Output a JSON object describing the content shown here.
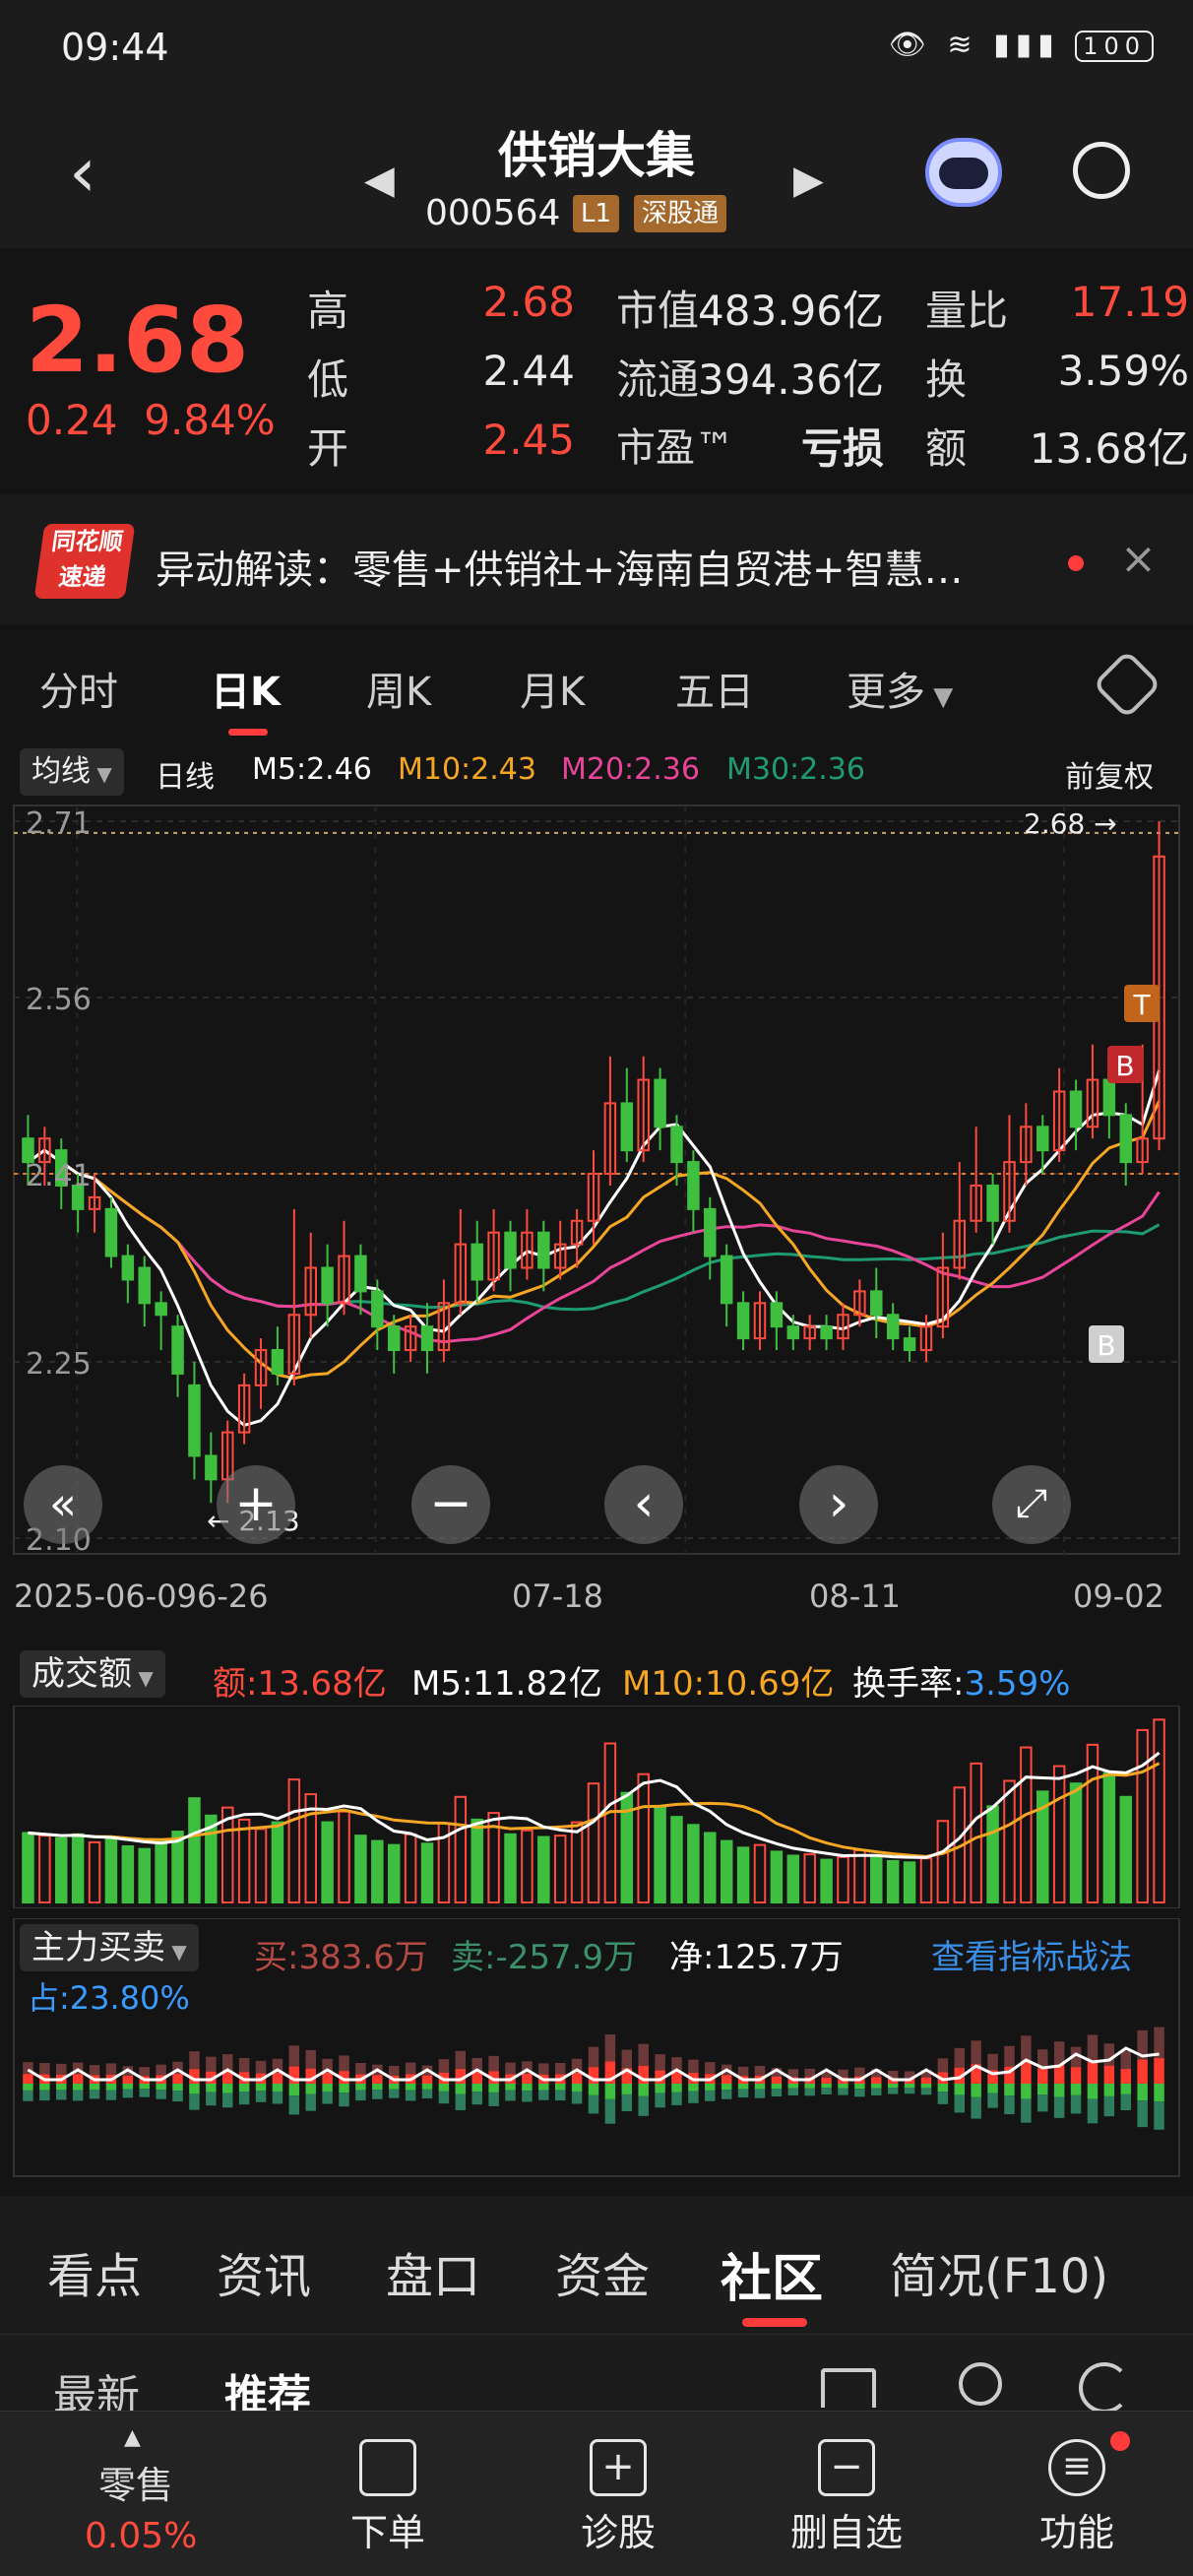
{
  "status": {
    "time": "09:44",
    "battery": "100"
  },
  "nav": {
    "title": "供销大集",
    "code": "000564",
    "level": "L1",
    "market": "深股通"
  },
  "quote": {
    "price": "2.68",
    "change": "0.24",
    "change_pct": "9.84%",
    "labels": {
      "high": "高",
      "low": "低",
      "open": "开",
      "mcap": "市值",
      "float": "流通",
      "pe": "市盈™",
      "vol_ratio": "量比",
      "turnover": "换",
      "amount": "额"
    },
    "high": "2.68",
    "low": "2.44",
    "open": "2.45",
    "mcap": "483.96亿",
    "float_cap": "394.36亿",
    "pe": "亏损",
    "vol_ratio": "17.19",
    "turnover": "3.59%",
    "amount": "13.68亿"
  },
  "news": {
    "brand_top": "同花顺",
    "brand_bottom": "速递",
    "text": "异动解读：零售+供销社+海南自贸港+智慧…"
  },
  "tabs": [
    "分时",
    "日K",
    "周K",
    "月K",
    "五日",
    "更多"
  ],
  "ma": {
    "selector": "均线",
    "period": "日线",
    "m5": "M5:2.46",
    "m10": "M10:2.43",
    "m20": "M20:2.36",
    "m30": "M30:2.36",
    "adjust": "前复权"
  },
  "price_axis": {
    "labels": [
      "2.71",
      "2.56",
      "2.41",
      "2.25",
      "2.10"
    ],
    "high_label": "2.68",
    "low_label": "2.13"
  },
  "date_axis": [
    "2025-06-09",
    "6-26",
    "07-18",
    "08-11",
    "09-02"
  ],
  "markers": {
    "t": "T",
    "b": "B"
  },
  "volume": {
    "selector": "成交额",
    "amount": "额:13.68亿",
    "m5": "M5:11.82亿",
    "m10": "M10:10.69亿",
    "turnover_label": "换手率:",
    "turnover_value": "3.59%"
  },
  "mainforce": {
    "selector": "主力买卖",
    "buy": "买:383.6万",
    "sell": "卖:-257.9万",
    "net": "净:125.7万",
    "link": "查看指标战法",
    "share": "占:23.80%"
  },
  "bottom_tabs": [
    "看点",
    "资讯",
    "盘口",
    "资金",
    "社区",
    "简况(F10)"
  ],
  "sub_tabs": [
    "最新",
    "推荐"
  ],
  "bottom_bar": {
    "sector": "零售",
    "sector_pct": "0.05%",
    "items": [
      "下单",
      "诊股",
      "删自选",
      "功能"
    ]
  },
  "colors": {
    "up": "#ff4b3e",
    "down": "#3fbf3f",
    "ma5": "#ffffff",
    "ma10": "#f5a623",
    "ma20": "#e8449a",
    "ma30": "#1e9b73",
    "accent": "#ff3b3b"
  },
  "chart_data": {
    "type": "candlestick",
    "axis": {
      "ylim": [
        2.1,
        2.71
      ],
      "ticks": [
        2.71,
        2.56,
        2.41,
        2.25,
        2.1
      ]
    },
    "candles": [
      [
        2.44,
        2.42,
        2.46,
        2.4
      ],
      [
        2.42,
        2.44,
        2.45,
        2.4
      ],
      [
        2.43,
        2.4,
        2.44,
        2.38
      ],
      [
        2.4,
        2.38,
        2.41,
        2.36
      ],
      [
        2.38,
        2.39,
        2.41,
        2.36
      ],
      [
        2.38,
        2.34,
        2.39,
        2.33
      ],
      [
        2.34,
        2.32,
        2.35,
        2.3
      ],
      [
        2.33,
        2.3,
        2.34,
        2.28
      ],
      [
        2.3,
        2.29,
        2.31,
        2.26
      ],
      [
        2.28,
        2.24,
        2.29,
        2.22
      ],
      [
        2.23,
        2.17,
        2.25,
        2.15
      ],
      [
        2.17,
        2.15,
        2.19,
        2.13
      ],
      [
        2.15,
        2.19,
        2.2,
        2.13
      ],
      [
        2.19,
        2.23,
        2.24,
        2.18
      ],
      [
        2.23,
        2.26,
        2.27,
        2.21
      ],
      [
        2.26,
        2.24,
        2.28,
        2.23
      ],
      [
        2.24,
        2.29,
        2.38,
        2.23
      ],
      [
        2.29,
        2.33,
        2.36,
        2.27
      ],
      [
        2.33,
        2.3,
        2.35,
        2.28
      ],
      [
        2.3,
        2.34,
        2.37,
        2.29
      ],
      [
        2.34,
        2.31,
        2.35,
        2.29
      ],
      [
        2.31,
        2.28,
        2.32,
        2.26
      ],
      [
        2.28,
        2.26,
        2.29,
        2.24
      ],
      [
        2.26,
        2.28,
        2.29,
        2.25
      ],
      [
        2.28,
        2.26,
        2.3,
        2.24
      ],
      [
        2.26,
        2.3,
        2.32,
        2.25
      ],
      [
        2.3,
        2.35,
        2.38,
        2.29
      ],
      [
        2.35,
        2.32,
        2.37,
        2.3
      ],
      [
        2.32,
        2.36,
        2.38,
        2.31
      ],
      [
        2.36,
        2.33,
        2.37,
        2.31
      ],
      [
        2.33,
        2.36,
        2.38,
        2.32
      ],
      [
        2.36,
        2.33,
        2.37,
        2.31
      ],
      [
        2.33,
        2.35,
        2.37,
        2.32
      ],
      [
        2.35,
        2.37,
        2.38,
        2.33
      ],
      [
        2.37,
        2.41,
        2.43,
        2.35
      ],
      [
        2.41,
        2.47,
        2.51,
        2.4
      ],
      [
        2.47,
        2.43,
        2.5,
        2.42
      ],
      [
        2.43,
        2.49,
        2.51,
        2.42
      ],
      [
        2.49,
        2.45,
        2.5,
        2.43
      ],
      [
        2.45,
        2.42,
        2.46,
        2.4
      ],
      [
        2.42,
        2.38,
        2.43,
        2.36
      ],
      [
        2.38,
        2.34,
        2.39,
        2.32
      ],
      [
        2.34,
        2.3,
        2.35,
        2.28
      ],
      [
        2.3,
        2.27,
        2.31,
        2.26
      ],
      [
        2.27,
        2.3,
        2.31,
        2.26
      ],
      [
        2.3,
        2.28,
        2.31,
        2.26
      ],
      [
        2.28,
        2.27,
        2.29,
        2.26
      ],
      [
        2.27,
        2.28,
        2.29,
        2.26
      ],
      [
        2.28,
        2.27,
        2.29,
        2.26
      ],
      [
        2.27,
        2.29,
        2.3,
        2.26
      ],
      [
        2.29,
        2.31,
        2.32,
        2.28
      ],
      [
        2.31,
        2.29,
        2.33,
        2.27
      ],
      [
        2.29,
        2.27,
        2.3,
        2.26
      ],
      [
        2.27,
        2.26,
        2.28,
        2.25
      ],
      [
        2.26,
        2.28,
        2.29,
        2.25
      ],
      [
        2.28,
        2.33,
        2.36,
        2.27
      ],
      [
        2.33,
        2.37,
        2.42,
        2.32
      ],
      [
        2.37,
        2.4,
        2.45,
        2.36
      ],
      [
        2.4,
        2.37,
        2.41,
        2.35
      ],
      [
        2.37,
        2.42,
        2.46,
        2.36
      ],
      [
        2.42,
        2.45,
        2.47,
        2.4
      ],
      [
        2.45,
        2.43,
        2.46,
        2.41
      ],
      [
        2.43,
        2.48,
        2.5,
        2.42
      ],
      [
        2.48,
        2.45,
        2.49,
        2.43
      ],
      [
        2.45,
        2.49,
        2.52,
        2.44
      ],
      [
        2.49,
        2.46,
        2.5,
        2.44
      ],
      [
        2.46,
        2.42,
        2.47,
        2.4
      ],
      [
        2.42,
        2.44,
        2.52,
        2.41
      ],
      [
        2.44,
        2.68,
        2.71,
        2.43
      ]
    ],
    "volume_amount": [
      5.2,
      5.0,
      4.8,
      5.1,
      4.5,
      4.9,
      4.2,
      4.0,
      4.6,
      5.3,
      7.8,
      6.5,
      7.1,
      6.2,
      5.5,
      6.0,
      9.2,
      8.1,
      6.0,
      6.8,
      5.0,
      4.6,
      4.3,
      5.1,
      4.4,
      5.9,
      7.9,
      6.2,
      6.7,
      5.1,
      5.4,
      4.9,
      5.0,
      6.0,
      8.9,
      11.9,
      8.2,
      9.6,
      7.1,
      6.4,
      5.8,
      5.2,
      4.6,
      4.1,
      4.3,
      3.8,
      3.5,
      3.6,
      3.2,
      3.4,
      3.9,
      3.5,
      3.1,
      3.0,
      3.3,
      6.1,
      8.6,
      10.4,
      7.2,
      9.1,
      11.6,
      8.3,
      10.2,
      8.9,
      11.8,
      9.7,
      7.9,
      12.9,
      13.68
    ]
  }
}
